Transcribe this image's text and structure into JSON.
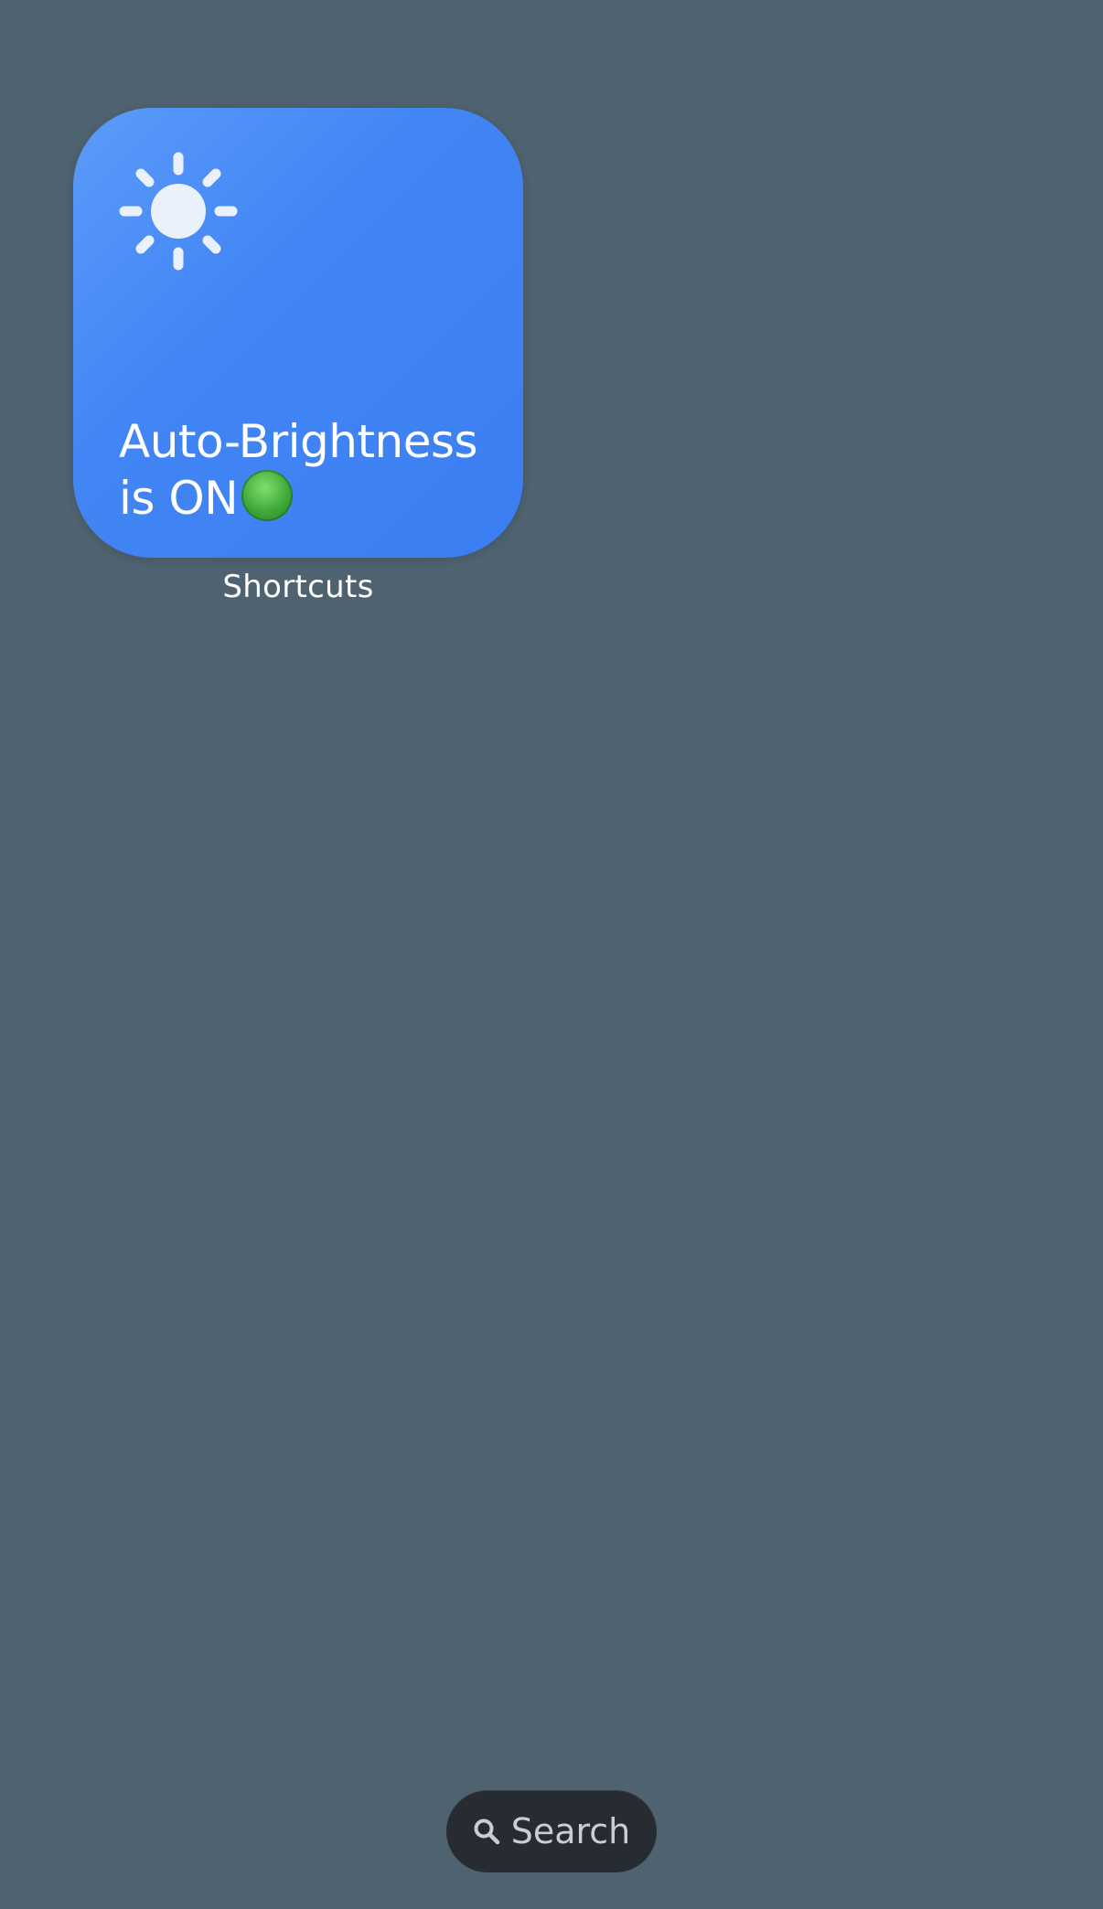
{
  "widget": {
    "icon": "sun-icon",
    "line1": "Auto-Brightness",
    "line2": "is ON",
    "status_icon": "green-circle-icon",
    "label": "Shortcuts",
    "colors": {
      "gradient_start": "#5b9bfa",
      "gradient_end": "#3a7ef2",
      "status_green": "#3fa83a"
    }
  },
  "search": {
    "icon": "search-icon",
    "label": "Search"
  },
  "background_color": "#4e626f"
}
